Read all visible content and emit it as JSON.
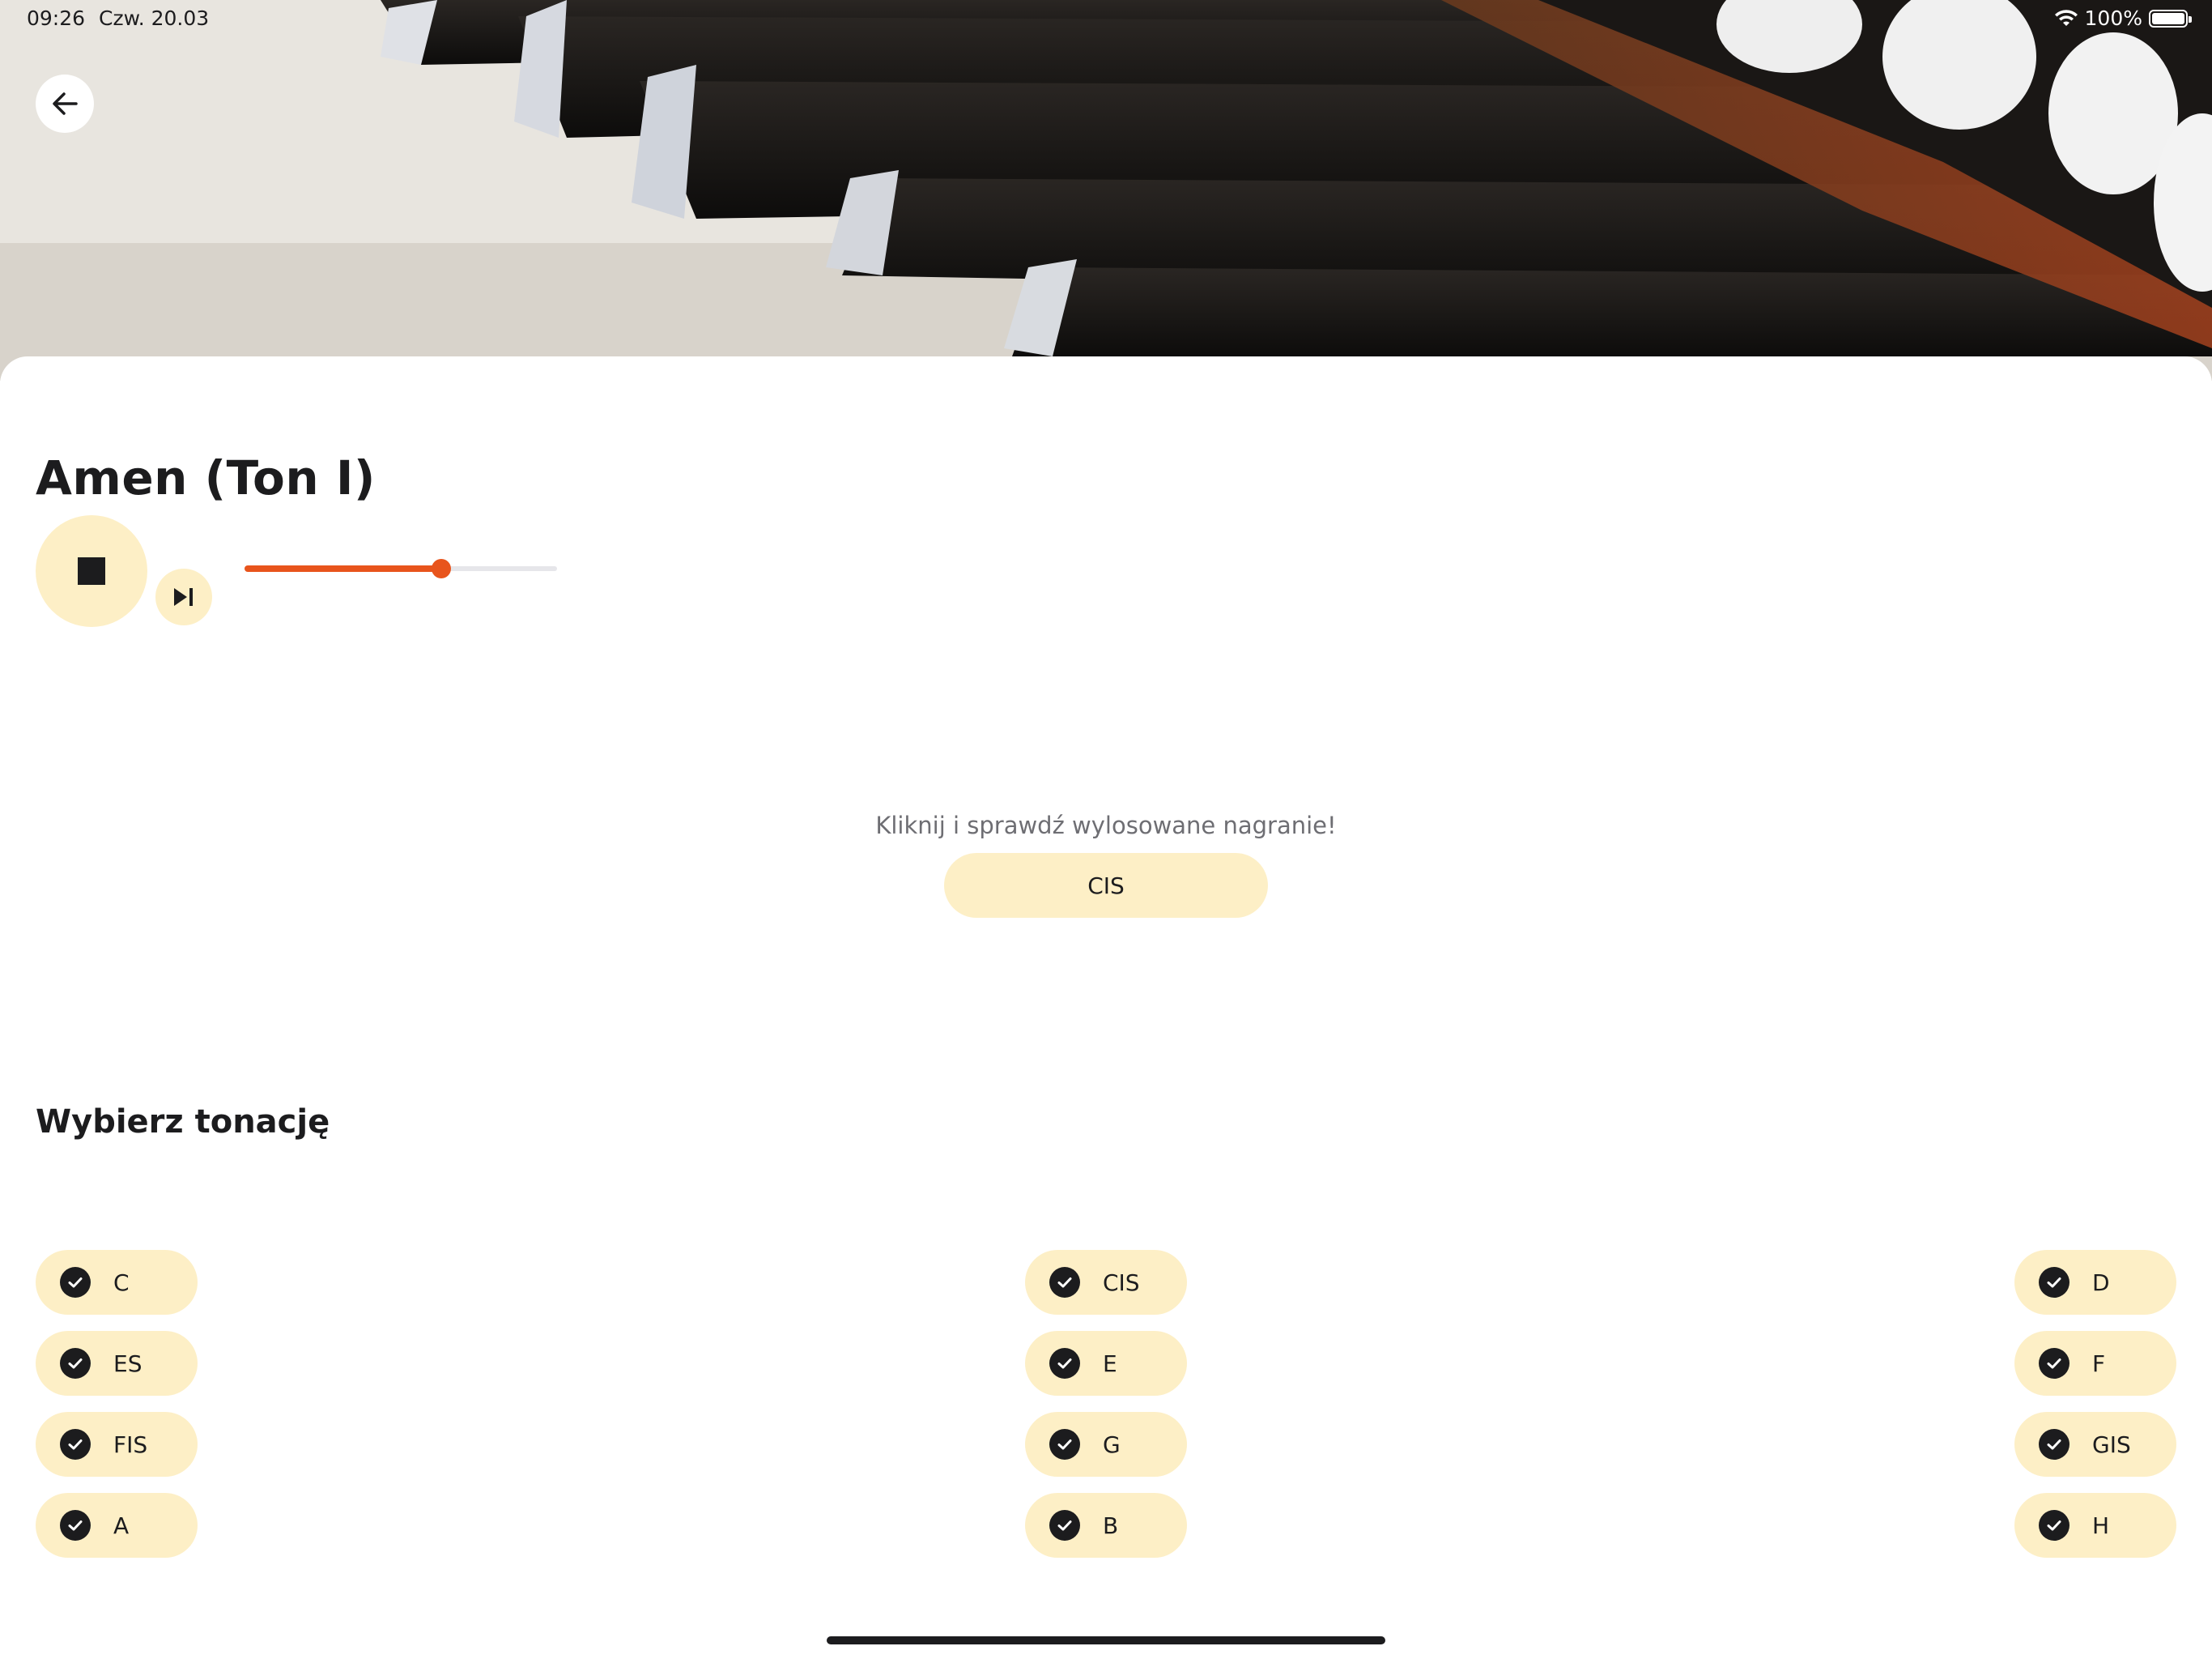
{
  "status_bar": {
    "time": "09:26",
    "date": "Czw. 20.03",
    "battery": "100%"
  },
  "header": {
    "back_icon": "arrow-left-icon"
  },
  "player": {
    "title": "Amen (Ton I)",
    "stop_icon": "stop-icon",
    "skip_icon": "skip-next-icon",
    "progress_fraction": 0.63,
    "accent_color": "#e8541c",
    "button_color": "#fdefc6"
  },
  "reveal": {
    "hint": "Kliknij i sprawdź wylosowane nagranie!",
    "answer": "CIS"
  },
  "keys_section": {
    "title": "Wybierz tonację",
    "keys": [
      {
        "label": "C",
        "selected": true
      },
      {
        "label": "CIS",
        "selected": true
      },
      {
        "label": "D",
        "selected": true
      },
      {
        "label": "ES",
        "selected": true
      },
      {
        "label": "E",
        "selected": true
      },
      {
        "label": "F",
        "selected": true
      },
      {
        "label": "FIS",
        "selected": true
      },
      {
        "label": "G",
        "selected": true
      },
      {
        "label": "GIS",
        "selected": true
      },
      {
        "label": "A",
        "selected": true
      },
      {
        "label": "B",
        "selected": true
      },
      {
        "label": "H",
        "selected": true
      }
    ]
  }
}
